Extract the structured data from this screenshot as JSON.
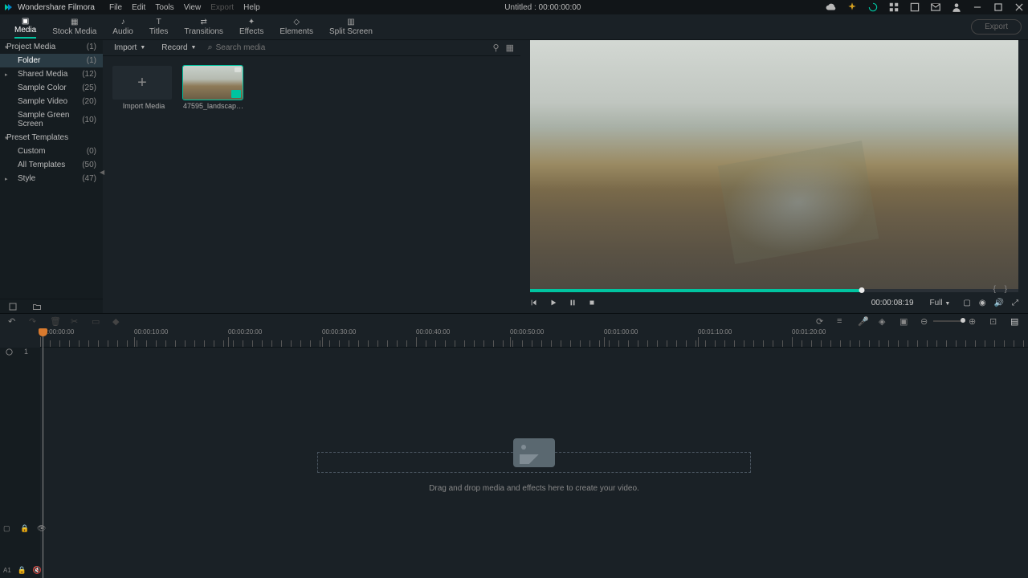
{
  "app_name": "Wondershare Filmora",
  "menu": {
    "file": "File",
    "edit": "Edit",
    "tools": "Tools",
    "view": "View",
    "export": "Export",
    "help": "Help"
  },
  "doc_title": "Untitled : 00:00:00:00",
  "tabs": {
    "media": "Media",
    "stock": "Stock Media",
    "audio": "Audio",
    "titles": "Titles",
    "transitions": "Transitions",
    "effects": "Effects",
    "elements": "Elements",
    "split": "Split Screen"
  },
  "export_btn": "Export",
  "sidebar": {
    "items": [
      {
        "label": "Project Media",
        "count": "(1)",
        "lvl": 0,
        "arrow": "▾"
      },
      {
        "label": "Folder",
        "count": "(1)",
        "lvl": 1,
        "sel": true
      },
      {
        "label": "Shared Media",
        "count": "(12)",
        "lvl": 1,
        "arrow": "▸"
      },
      {
        "label": "Sample Color",
        "count": "(25)",
        "lvl": 1
      },
      {
        "label": "Sample Video",
        "count": "(20)",
        "lvl": 1
      },
      {
        "label": "Sample Green Screen",
        "count": "(10)",
        "lvl": 1
      },
      {
        "label": "Preset Templates",
        "count": "",
        "lvl": 0,
        "arrow": "▾"
      },
      {
        "label": "Custom",
        "count": "(0)",
        "lvl": 1
      },
      {
        "label": "All Templates",
        "count": "(50)",
        "lvl": 1
      },
      {
        "label": "Style",
        "count": "(47)",
        "lvl": 1,
        "arrow": "▸"
      }
    ]
  },
  "media_bar": {
    "import": "Import",
    "record": "Record",
    "search_ph": "Search media"
  },
  "media_items": {
    "import": "Import Media",
    "clip": "47595_landscape_of_..."
  },
  "preview": {
    "time": "00:00:08:19",
    "quality": "Full"
  },
  "timeline": {
    "ticks": [
      "00:00:00:00",
      "00:00:10:00",
      "00:00:20:00",
      "00:00:30:00",
      "00:00:40:00",
      "00:00:50:00",
      "00:01:00:00",
      "00:01:10:00",
      "00:01:20:00"
    ],
    "drop_hint": "Drag and drop media and effects here to create your video."
  },
  "colors": {
    "accent": "#00c4a0",
    "bg": "#1a2126"
  }
}
